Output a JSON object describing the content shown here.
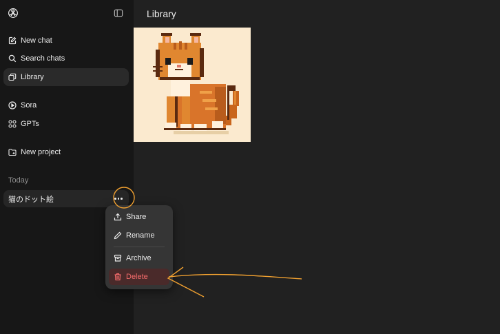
{
  "sidebar": {
    "nav": [
      {
        "label": "New chat",
        "icon": "new-chat-icon"
      },
      {
        "label": "Search chats",
        "icon": "search-icon"
      },
      {
        "label": "Library",
        "icon": "library-icon"
      },
      {
        "label": "Sora",
        "icon": "play-circle-icon"
      },
      {
        "label": "GPTs",
        "icon": "grid-icon"
      },
      {
        "label": "New project",
        "icon": "folder-plus-icon"
      }
    ],
    "section_label": "Today",
    "chats": [
      {
        "title": "猫のドット絵"
      }
    ]
  },
  "main": {
    "title": "Library",
    "image_alt": "pixel-art orange tabby cat"
  },
  "context_menu": {
    "items": [
      {
        "label": "Share",
        "icon": "share-icon"
      },
      {
        "label": "Rename",
        "icon": "pencil-icon"
      },
      {
        "label": "Archive",
        "icon": "archive-icon"
      },
      {
        "label": "Delete",
        "icon": "trash-icon",
        "danger": true
      }
    ]
  },
  "colors": {
    "accent_annotation": "#f0a030",
    "danger": "#f46b6b",
    "sidebar_bg": "#171717",
    "main_bg": "#212121"
  }
}
